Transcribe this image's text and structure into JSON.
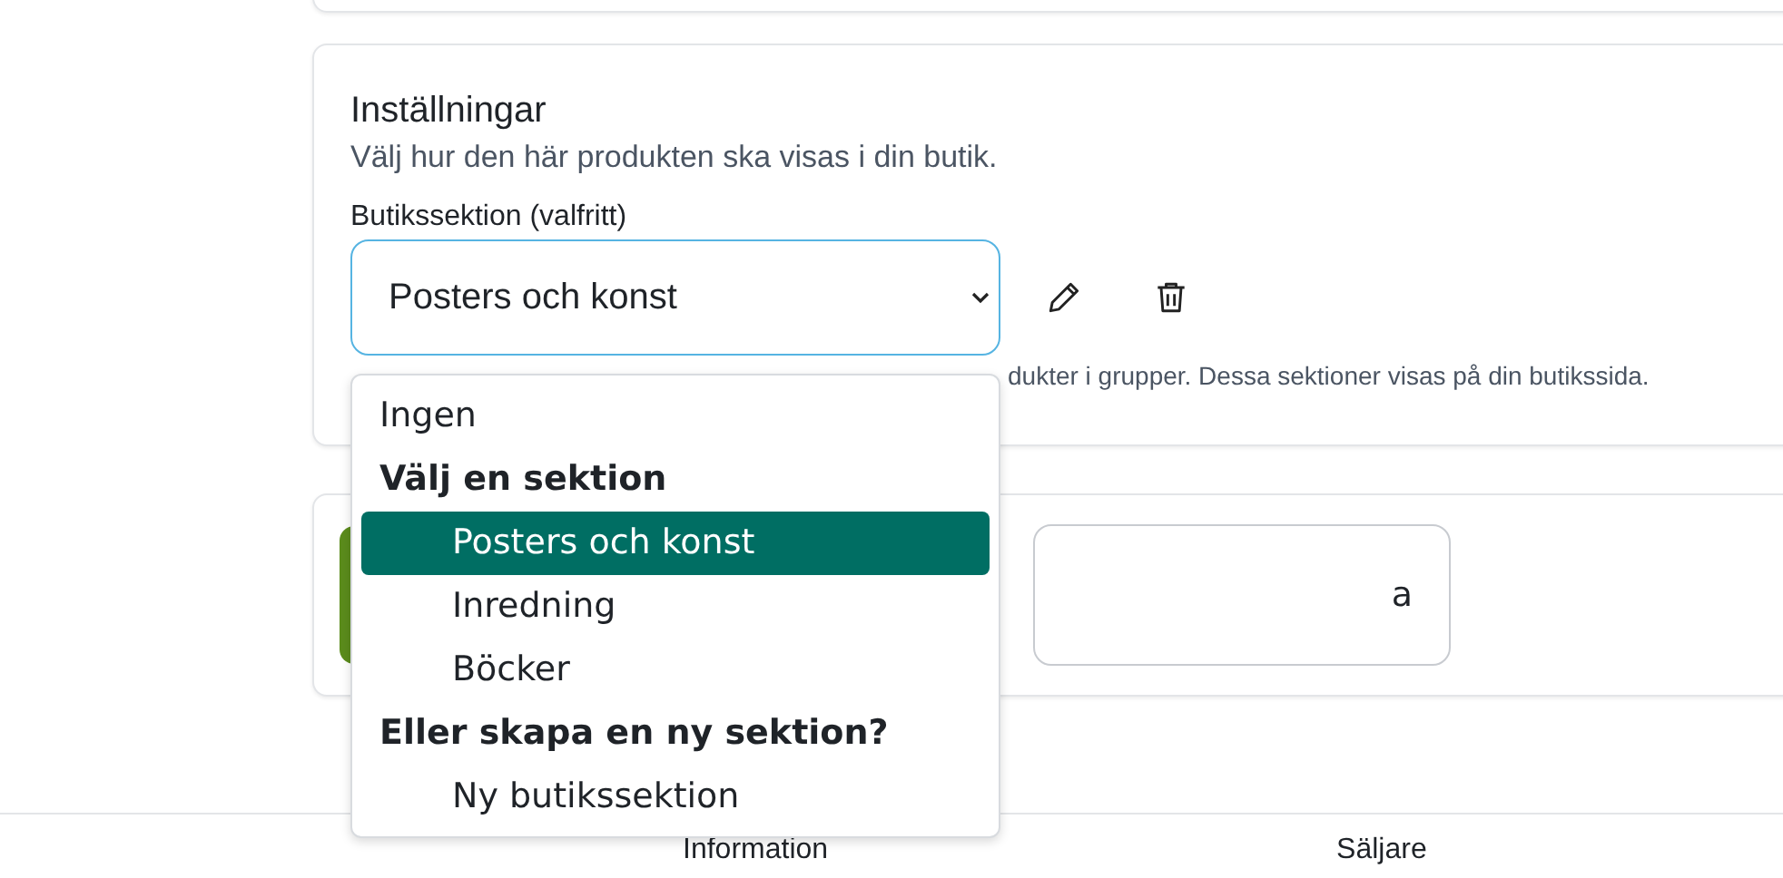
{
  "settings": {
    "title": "Inställningar",
    "subtitle": "Välj hur den här produkten ska visas i din butik.",
    "field_label": "Butikssektion (valfritt)",
    "select_value": "Posters och konst",
    "hint": "dukter i grupper. Dessa sektioner visas på din butikssida."
  },
  "dropdown": [
    {
      "kind": "option",
      "label": "Ingen",
      "selected": false
    },
    {
      "kind": "group",
      "label": "Välj en sektion"
    },
    {
      "kind": "suboption",
      "label": "Posters och konst",
      "selected": true
    },
    {
      "kind": "suboption",
      "label": "Inredning",
      "selected": false
    },
    {
      "kind": "suboption",
      "label": "Böcker",
      "selected": false
    },
    {
      "kind": "group",
      "label": "Eller skapa en ny sektion?"
    },
    {
      "kind": "suboption",
      "label": "Ny butikssektion",
      "selected": false
    }
  ],
  "actions": {
    "secondary_button": "a"
  },
  "footer": [
    "Information",
    "Säljare"
  ]
}
